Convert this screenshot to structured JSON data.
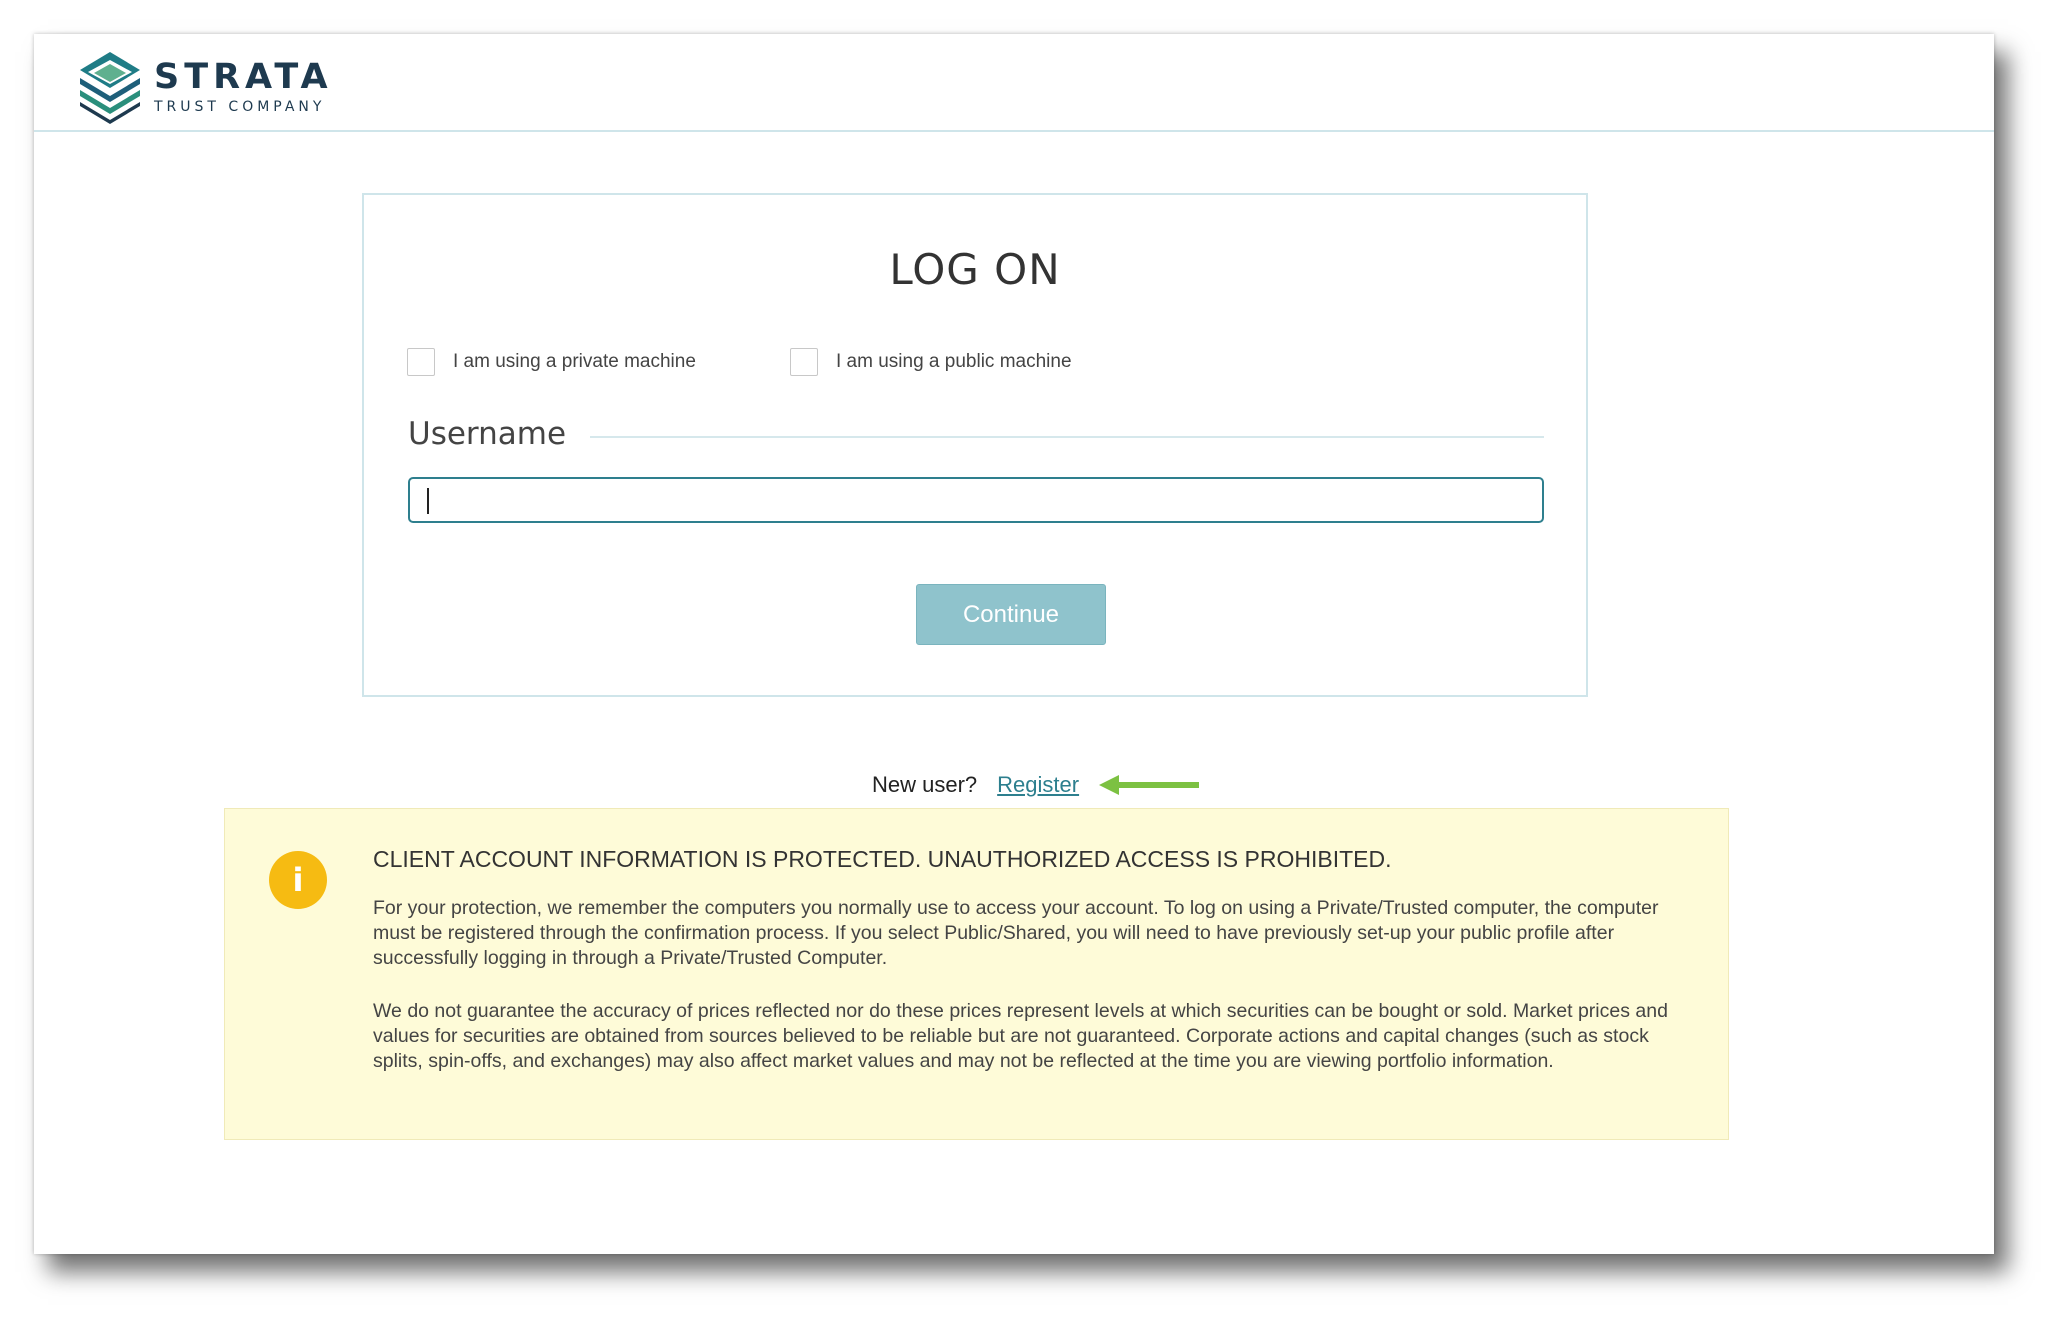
{
  "header": {
    "logo_name": "STRATA",
    "logo_subtitle": "TRUST COMPANY"
  },
  "login": {
    "title": "LOG ON",
    "private_machine_label": "I am using a private machine",
    "public_machine_label": "I am using a public machine",
    "username_label": "Username",
    "username_value": "",
    "continue_label": "Continue"
  },
  "register": {
    "prompt": "New user?",
    "link_label": "Register",
    "arrow_color": "#7cc142"
  },
  "notice": {
    "icon": "info-icon",
    "heading": "CLIENT ACCOUNT INFORMATION IS PROTECTED. UNAUTHORIZED ACCESS IS PROHIBITED.",
    "paragraph1": "For your protection, we remember the computers you normally use to access your account. To log on using a Private/Trusted computer, the computer must be registered through the confirmation process. If you select Public/Shared, you will need to have previously set-up your public profile after successfully logging in through a Private/Trusted Computer.",
    "paragraph2": "We do not guarantee the accuracy of prices reflected nor do these prices represent levels at which securities can be bought or sold. Market prices and values for securities are obtained from sources believed to be reliable but are not guaranteed. Corporate actions and capital changes (such as stock splits, spin-offs, and exchanges) may also affect market values and may not be reflected at the time you are viewing portfolio information."
  },
  "colors": {
    "brand_dark": "#1e3a4f",
    "brand_teal": "#2e7f8e",
    "button": "#8fc3cc",
    "notice_bg": "#fefbd8",
    "info_icon": "#f6bb12"
  }
}
